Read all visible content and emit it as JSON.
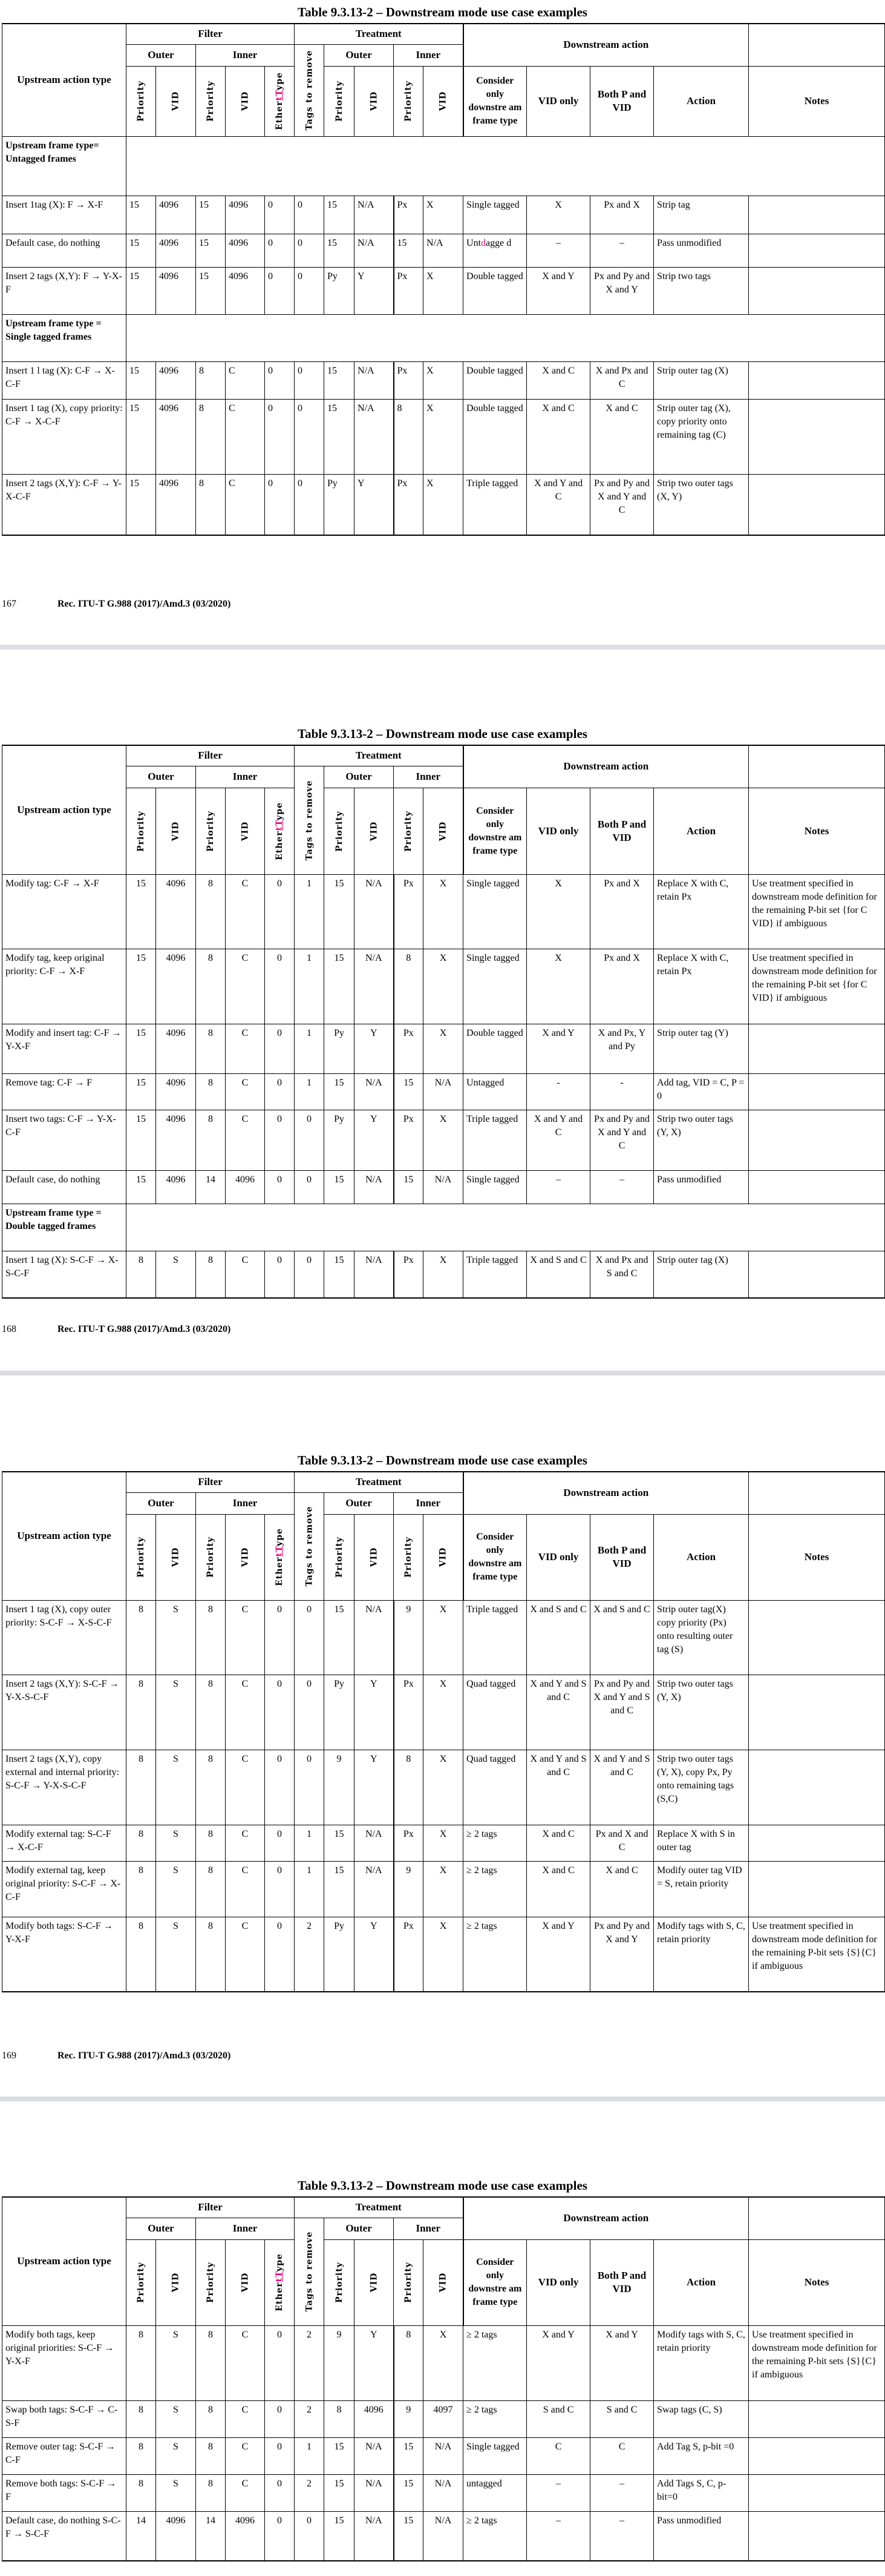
{
  "document": {
    "table_title": "Table 9.3.13-2 – Downstream mode use case examples",
    "footer_title": "Rec. ITU-T G.988 (2017)/Amd.3 (03/2020)",
    "accent_color": "#e6007e",
    "header": {
      "upstream_action_type": "Upstream action type",
      "filter": "Filter",
      "treatment": "Treatment",
      "downstream_action": "Downstream action",
      "outer": "Outer",
      "inner": "Inner",
      "priority": "Priority",
      "vid": "VID",
      "ethertype_prefix": "Ether",
      "ethertype_mark": "tT",
      "ethertype_suffix": "ype",
      "tags_to_remove": "Tags to remove",
      "consider_only": "Consider only downstre am frame type",
      "vid_only": "VID only",
      "both_p_and_vid": "Both P and VID",
      "action": "Action",
      "notes": "Notes"
    }
  },
  "pages": [
    {
      "page_number": "167",
      "rows": [
        {
          "section": "Upstream frame type= Untagged frames"
        },
        {
          "type": "Insert 1tag (X): F → X-F",
          "cells": [
            "15",
            "4096",
            "15",
            "4096",
            "0",
            "0",
            "15",
            "N/A",
            "Px",
            "X",
            "Single tagged",
            "X",
            "Px and X",
            "Strip tag",
            ""
          ]
        },
        {
          "type": "Default case, do nothing",
          "cells": [
            "15",
            "4096",
            "15",
            "4096",
            "0",
            "0",
            "15",
            "N/A",
            "15",
            "N/A",
            "Untdagged",
            "–",
            "–",
            "Pass unmodified",
            ""
          ]
        },
        {
          "type": "Insert 2 tags (X,Y): F → Y-X-F",
          "cells": [
            "15",
            "4096",
            "15",
            "4096",
            "0",
            "0",
            "Py",
            "Y",
            "Px",
            "X",
            "Double tagged",
            "X and Y",
            "Px and Py and X and Y",
            "Strip two tags",
            ""
          ]
        },
        {
          "section": "Upstream frame type = Single tagged frames"
        },
        {
          "type": "Insert 1 l tag (X): C-F → X-C-F",
          "cells": [
            "15",
            "4096",
            "8",
            "C",
            "0",
            "0",
            "15",
            "N/A",
            "Px",
            "X",
            "Double tagged",
            "X and C",
            "X and Px and C",
            "Strip outer tag (X)",
            ""
          ]
        },
        {
          "type": "Insert 1 tag (X), copy priority: C-F → X-C-F",
          "cells": [
            "15",
            "4096",
            "8",
            "C",
            "0",
            "0",
            "15",
            "N/A",
            "8",
            "X",
            "Double tagged",
            "X and C",
            "X and C",
            "Strip outer tag (X), copy priority onto remaining tag (C)",
            ""
          ]
        },
        {
          "type": "Insert 2 tags (X,Y): C-F → Y-X-C-F",
          "cells": [
            "15",
            "4096",
            "8",
            "C",
            "0",
            "0",
            "Py",
            "Y",
            "Px",
            "X",
            "Triple tagged",
            "X and Y and C",
            "Px and Py and X and Y and C",
            "Strip two outer tags (X, Y)",
            ""
          ]
        }
      ]
    },
    {
      "page_number": "168",
      "rows": [
        {
          "type": "Modify tag: C-F → X-F",
          "cells": [
            "15",
            "4096",
            "8",
            "C",
            "0",
            "1",
            "15",
            "N/A",
            "Px",
            "X",
            "Single tagged",
            "X",
            "Px and X",
            "Replace X with C, retain Px",
            "Use treatment specified in downstream mode definition for the remaining P-bit set {for C VID} if ambiguous"
          ]
        },
        {
          "type": "Modify tag, keep original priority: C-F → X-F",
          "cells": [
            "15",
            "4096",
            "8",
            "C",
            "0",
            "1",
            "15",
            "N/A",
            "8",
            "X",
            "Single tagged",
            "X",
            "Px and X",
            "Replace X with C, retain Px",
            "Use treatment specified in downstream mode definition for the remaining P-bit set {for C VID} if ambiguous"
          ]
        },
        {
          "type": "Modify and insert tag: C-F → Y-X-F",
          "cells": [
            "15",
            "4096",
            "8",
            "C",
            "0",
            "1",
            "Py",
            "Y",
            "Px",
            "X",
            "Double tagged",
            "X and Y",
            "X and Px, Y and Py",
            "Strip outer tag (Y)",
            ""
          ]
        },
        {
          "type": "Remove tag: C-F → F",
          "cells": [
            "15",
            "4096",
            "8",
            "C",
            "0",
            "1",
            "15",
            "N/A",
            "15",
            "N/A",
            "Untagged",
            "-",
            "-",
            "Add tag, VID = C, P = 0",
            ""
          ]
        },
        {
          "type": "Insert two tags: C-F → Y-X-C-F",
          "cells": [
            "15",
            "4096",
            "8",
            "C",
            "0",
            "0",
            "Py",
            "Y",
            "Px",
            "X",
            "Triple tagged",
            "X and Y and C",
            "Px and Py and X and Y and C",
            "Strip two outer tags (Y, X)",
            ""
          ]
        },
        {
          "type": "Default case, do nothing",
          "cells": [
            "15",
            "4096",
            "14",
            "4096",
            "0",
            "0",
            "15",
            "N/A",
            "15",
            "N/A",
            "Single tagged",
            "–",
            "–",
            "Pass unmodified",
            ""
          ]
        },
        {
          "section": "Upstream frame type = Double tagged frames"
        },
        {
          "type": "Insert 1 tag (X): S-C-F → X-S-C-F",
          "cells": [
            "8",
            "S",
            "8",
            "C",
            "0",
            "0",
            "15",
            "N/A",
            "Px",
            "X",
            "Triple tagged",
            "X and S and C",
            "X and Px and S and C",
            "Strip outer tag (X)",
            ""
          ]
        }
      ]
    },
    {
      "page_number": "169",
      "rows": [
        {
          "type": "Insert 1 tag (X), copy outer priority: S-C-F → X-S-C-F",
          "cells": [
            "8",
            "S",
            "8",
            "C",
            "0",
            "0",
            "15",
            "N/A",
            "9",
            "X",
            "Triple tagged",
            "X and S and C",
            "X and S and C",
            "Strip outer tag(X) copy priority (Px) onto resulting outer tag (S)",
            ""
          ]
        },
        {
          "type": "Insert 2 tags (X,Y): S-C-F → Y-X-S-C-F",
          "cells": [
            "8",
            "S",
            "8",
            "C",
            "0",
            "0",
            "Py",
            "Y",
            "Px",
            "X",
            "Quad tagged",
            "X and Y and S and C",
            "Px and Py and X and Y and S and C",
            "Strip two outer tags (Y, X)",
            ""
          ]
        },
        {
          "type": "Insert 2 tags (X,Y), copy external and internal priority: S-C-F → Y-X-S-C-F",
          "cells": [
            "8",
            "S",
            "8",
            "C",
            "0",
            "0",
            "9",
            "Y",
            "8",
            "X",
            "Quad tagged",
            "X and Y and S and C",
            "X and Y and S and C",
            "Strip two outer tags (Y, X), copy Px, Py onto remaining tags (S,C)",
            ""
          ]
        },
        {
          "type": "Modify external tag: S-C-F → X-C-F",
          "cells": [
            "8",
            "S",
            "8",
            "C",
            "0",
            "1",
            "15",
            "N/A",
            "Px",
            "X",
            "≥ 2 tags",
            "X and C",
            "Px and X and C",
            "Replace X with S in outer tag",
            ""
          ]
        },
        {
          "type": "Modify external tag, keep original priority: S-C-F → X-C-F",
          "cells": [
            "8",
            "S",
            "8",
            "C",
            "0",
            "1",
            "15",
            "N/A",
            "9",
            "X",
            "≥ 2 tags",
            "X and C",
            "X and C",
            "Modify outer tag VID = S, retain priority",
            ""
          ]
        },
        {
          "type": "Modify both tags: S-C-F → Y-X-F",
          "cells": [
            "8",
            "S",
            "8",
            "C",
            "0",
            "2",
            "Py",
            "Y",
            "Px",
            "X",
            "≥ 2 tags",
            "X and Y",
            "Px and Py and X and Y",
            "Modify tags with S, C, retain priority",
            "Use treatment specified in downstream mode definition for the remaining P-bit sets {S}{C} if ambiguous"
          ]
        }
      ]
    },
    {
      "page_number": "",
      "rows": [
        {
          "type": "Modify both tags, keep original priorities: S-C-F → Y-X-F",
          "cells": [
            "8",
            "S",
            "8",
            "C",
            "0",
            "2",
            "9",
            "Y",
            "8",
            "X",
            "≥ 2 tags",
            "X and Y",
            "X and Y",
            "Modify tags with S, C, retain priority",
            "Use treatment specified in downstream mode definition for the remaining P-bit sets {S}{C} if ambiguous"
          ]
        },
        {
          "type": "Swap both tags: S-C-F → C-S-F",
          "cells": [
            "8",
            "S",
            "8",
            "C",
            "0",
            "2",
            "8",
            "4096",
            "9",
            "4097",
            "≥ 2 tags",
            "S and C",
            "S and C",
            "Swap tags (C, S)",
            ""
          ]
        },
        {
          "type": "Remove outer tag: S-C-F → C-F",
          "cells": [
            "8",
            "S",
            "8",
            "C",
            "0",
            "1",
            "15",
            "N/A",
            "15",
            "N/A",
            "Single tagged",
            "C",
            "C",
            "Add Tag S, p-bit =0",
            ""
          ]
        },
        {
          "type": "Remove both tags: S-C-F → F",
          "cells": [
            "8",
            "S",
            "8",
            "C",
            "0",
            "2",
            "15",
            "N/A",
            "15",
            "N/A",
            "untagged",
            "–",
            "–",
            "Add Tags S, C, p-bit=0",
            ""
          ]
        },
        {
          "type": "Default case, do nothing S-C-F → S-C-F",
          "cells": [
            "14",
            "4096",
            "14",
            "4096",
            "0",
            "0",
            "15",
            "N/A",
            "15",
            "N/A",
            "≥ 2 tags",
            "–",
            "–",
            "Pass unmodified",
            ""
          ]
        }
      ]
    }
  ]
}
